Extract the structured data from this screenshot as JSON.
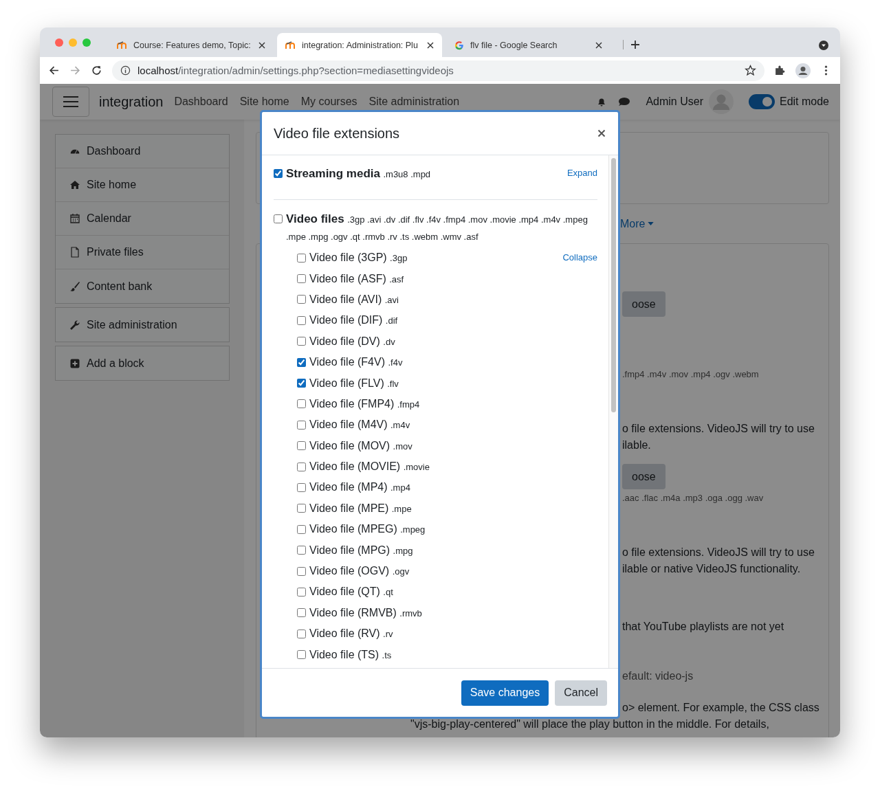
{
  "browser": {
    "tabs": [
      {
        "title": "Course: Features demo, Topic:",
        "selected": false
      },
      {
        "title": "integration: Administration: Plu",
        "selected": true
      },
      {
        "title": "flv file - Google Search",
        "selected": false
      }
    ],
    "url": {
      "host": "localhost",
      "path": "/integration/admin/settings.php?section=mediasettingvideojs"
    }
  },
  "page": {
    "brand": "integration",
    "nav": [
      "Dashboard",
      "Site home",
      "My courses",
      "Site administration"
    ],
    "user_name": "Admin User",
    "edit_mode": {
      "label": "Edit mode",
      "on": true
    }
  },
  "sidebar": {
    "items": [
      {
        "label": "Dashboard"
      },
      {
        "label": "Site home"
      },
      {
        "label": "Calendar"
      },
      {
        "label": "Private files"
      },
      {
        "label": "Content bank"
      },
      {
        "label": "Site administration"
      },
      {
        "label": "Add a block"
      }
    ]
  },
  "background": {
    "more": "More",
    "buttons": [
      "oose",
      "oose"
    ],
    "texts": [
      {
        "kind": "ext",
        "text": ".fmp4 .m4v .mov .mp4 .ogv .webm"
      },
      {
        "kind": "para",
        "text": "o file extensions. VideoJS will try to use"
      },
      {
        "kind": "para",
        "text": "ilable."
      },
      {
        "kind": "button"
      },
      {
        "kind": "ext",
        "text": ".aac .flac .m4a .mp3 .oga .ogg .wav"
      },
      {
        "kind": "para",
        "text": "o file extensions. VideoJS will try to use"
      },
      {
        "kind": "para",
        "text": "ilable or native VideoJS functionality."
      },
      {
        "kind": "para",
        "text": "that YouTube playlists are not yet"
      },
      {
        "kind": "hint",
        "text": "efault: video-js"
      },
      {
        "kind": "para",
        "text": "o> element. For example, the CSS class"
      },
      {
        "kind": "wide",
        "text": "\"vjs-big-play-centered\" will place the play button in the middle. For details,"
      }
    ]
  },
  "modal": {
    "title": "Video file extensions",
    "groups": [
      {
        "label": "Streaming media",
        "extensions": ".m3u8 .mpd",
        "checked": true,
        "toggle": "Expand"
      },
      {
        "label": "Video files",
        "extensions": ".3gp .avi .dv .dif .flv .f4v .fmp4 .mov .movie .mp4 .m4v .mpeg .mpe .mpg .ogv .qt .rmvb .rv .ts .webm .wmv .asf",
        "checked": false,
        "toggle": "Collapse",
        "items": [
          {
            "label": "Video file (3GP)",
            "ext": ".3gp",
            "checked": false
          },
          {
            "label": "Video file (ASF)",
            "ext": ".asf",
            "checked": false
          },
          {
            "label": "Video file (AVI)",
            "ext": ".avi",
            "checked": false
          },
          {
            "label": "Video file (DIF)",
            "ext": ".dif",
            "checked": false
          },
          {
            "label": "Video file (DV)",
            "ext": ".dv",
            "checked": false
          },
          {
            "label": "Video file (F4V)",
            "ext": ".f4v",
            "checked": true
          },
          {
            "label": "Video file (FLV)",
            "ext": ".flv",
            "checked": true
          },
          {
            "label": "Video file (FMP4)",
            "ext": ".fmp4",
            "checked": false
          },
          {
            "label": "Video file (M4V)",
            "ext": ".m4v",
            "checked": false
          },
          {
            "label": "Video file (MOV)",
            "ext": ".mov",
            "checked": false
          },
          {
            "label": "Video file (MOVIE)",
            "ext": ".movie",
            "checked": false
          },
          {
            "label": "Video file (MP4)",
            "ext": ".mp4",
            "checked": false
          },
          {
            "label": "Video file (MPE)",
            "ext": ".mpe",
            "checked": false
          },
          {
            "label": "Video file (MPEG)",
            "ext": ".mpeg",
            "checked": false
          },
          {
            "label": "Video file (MPG)",
            "ext": ".mpg",
            "checked": false
          },
          {
            "label": "Video file (OGV)",
            "ext": ".ogv",
            "checked": false
          },
          {
            "label": "Video file (QT)",
            "ext": ".qt",
            "checked": false
          },
          {
            "label": "Video file (RMVB)",
            "ext": ".rmvb",
            "checked": false
          },
          {
            "label": "Video file (RV)",
            "ext": ".rv",
            "checked": false
          },
          {
            "label": "Video file (TS)",
            "ext": ".ts",
            "checked": false
          }
        ]
      }
    ],
    "buttons": [
      {
        "label": "Save changes",
        "kind": "primary"
      },
      {
        "label": "Cancel",
        "kind": "secondary"
      }
    ]
  }
}
